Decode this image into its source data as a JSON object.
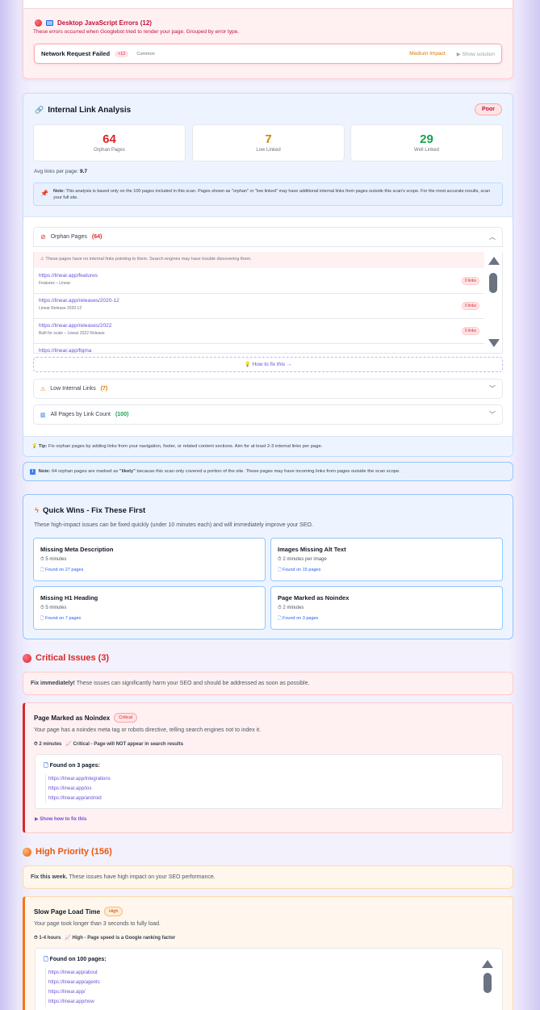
{
  "js_errors": {
    "title": "Desktop JavaScript Errors (12)",
    "subtitle": "These errors occurred when Googlebot tried to render your page. Grouped by error type.",
    "item": {
      "name": "Network Request Failed",
      "count": "×12",
      "tag": "Common",
      "impact": "Medium Impact",
      "action": "▶ Show solution"
    }
  },
  "internal_links": {
    "title": "Internal Link Analysis",
    "rating": "Poor",
    "stats": [
      {
        "value": "64",
        "label": "Orphan Pages",
        "color": "#dc2626"
      },
      {
        "value": "7",
        "label": "Low Linked",
        "color": "#ca8a04"
      },
      {
        "value": "29",
        "label": "Well Linked",
        "color": "#16a34a"
      }
    ],
    "avg_label": "Avg links per page:",
    "avg_value": "9.7",
    "note_label": "Note:",
    "note_text": "This analysis is based only on the 100 pages included in this scan. Pages shown as \"orphan\" or \"low linked\" may have additional internal links from pages outside this scan's scope. For the most accurate results, scan your full site.",
    "orphan": {
      "label": "Orphan Pages",
      "count": "(64)",
      "warning": "These pages have no internal links pointing to them. Search engines may have trouble discovering them.",
      "pages": [
        {
          "url": "https://linear.app/features",
          "title": "Features – Linear",
          "links": "0 links"
        },
        {
          "url": "https://linear.app/releases/2020-12",
          "title": "Linear Release 2020.12",
          "links": "0 links"
        },
        {
          "url": "https://linear.app/releases/2022",
          "title": "Built for scale – Linear 2022 Release",
          "links": "0 links"
        },
        {
          "url": "https://linear.app/figma",
          "title": "",
          "links": ""
        }
      ],
      "how_to_fix": "How to fix this →"
    },
    "low": {
      "label": "Low Internal Links",
      "count": "(7)"
    },
    "all": {
      "label": "All Pages by Link Count",
      "count": "(100)"
    },
    "tip_label": "Tip:",
    "tip_text": "Fix orphan pages by adding links from your navigation, footer, or related content sections. Aim for at least 2-3 internal links per page."
  },
  "likely_note": {
    "label": "Note:",
    "count": "64",
    "text_a": "orphan pages are marked as",
    "likely": "\"likely\"",
    "text_b": "because this scan only covered a portion of the site. These pages may have incoming links from pages outside the scan scope."
  },
  "quick_wins": {
    "title": "Quick Wins - Fix These First",
    "subtitle": "These high-impact issues can be fixed quickly (under 10 minutes each) and will immediately improve your SEO.",
    "items": [
      {
        "name": "Missing Meta Description",
        "time": "5 minutes",
        "found": "Found on 27 pages"
      },
      {
        "name": "Images Missing Alt Text",
        "time": "2 minutes per image",
        "found": "Found on 15 pages"
      },
      {
        "name": "Missing H1 Heading",
        "time": "5 minutes",
        "found": "Found on 7 pages"
      },
      {
        "name": "Page Marked as Noindex",
        "time": "2 minutes",
        "found": "Found on 3 pages"
      }
    ]
  },
  "critical": {
    "title": "Critical Issues (3)",
    "banner_strong": "Fix immediately!",
    "banner_text": "These issues can significantly harm your SEO and should be addressed as soon as possible.",
    "issue": {
      "title": "Page Marked as Noindex",
      "badge": "Critical",
      "desc": "Your page has a noindex meta tag or robots directive, telling search engines not to index it.",
      "time": "2 minutes",
      "impact": "Critical - Page will NOT appear in search results",
      "found": "Found on 3 pages:",
      "urls": [
        "https://linear.app/integrations",
        "https://linear.app/ios",
        "https://linear.app/android"
      ],
      "show_how": "▶ Show how to fix this"
    }
  },
  "high": {
    "title": "High Priority (156)",
    "banner_strong": "Fix this week.",
    "banner_text": "These issues have high impact on your SEO performance.",
    "issue": {
      "title": "Slow Page Load Time",
      "badge": "High",
      "desc": "Your page took longer than 3 seconds to fully load.",
      "time": "1-4 hours",
      "impact": "High - Page speed is a Google ranking factor",
      "found": "Found on 100 pages:",
      "urls": [
        "https://linear.app/about",
        "https://linear.app/agents",
        "https://linear.app/",
        "https://linear.app/now"
      ]
    }
  }
}
